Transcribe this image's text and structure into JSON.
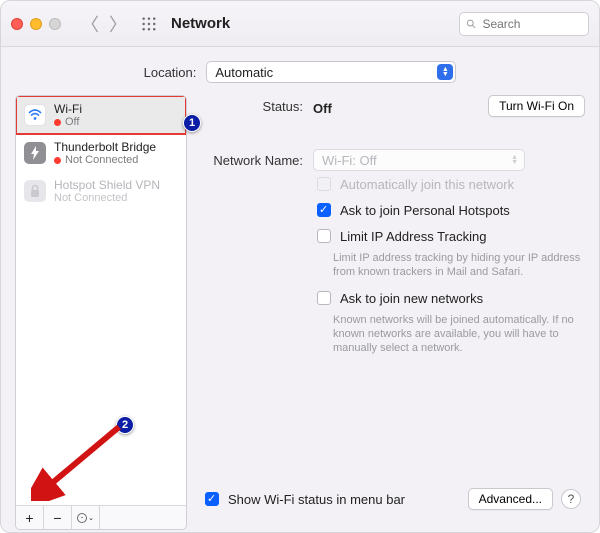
{
  "header": {
    "title": "Network",
    "search_placeholder": "Search"
  },
  "location": {
    "label": "Location:",
    "value": "Automatic"
  },
  "sidebar": {
    "items": [
      {
        "name": "Wi-Fi",
        "status_label": "Off",
        "status_color": "#ff3b30"
      },
      {
        "name": "Thunderbolt Bridge",
        "status_label": "Not Connected",
        "status_color": "#ff3b30"
      },
      {
        "name": "Hotspot Shield VPN",
        "status_label": "Not Connected",
        "status_color": ""
      }
    ]
  },
  "main": {
    "status_label": "Status:",
    "status_value": "Off",
    "toggle_button": "Turn Wi-Fi On",
    "network_name_label": "Network Name:",
    "network_name_value": "Wi-Fi: Off",
    "auto_join_label": "Automatically join this network",
    "ask_hotspots_label": "Ask to join Personal Hotspots",
    "limit_ip_label": "Limit IP Address Tracking",
    "limit_ip_sub": "Limit IP address tracking by hiding your IP address from known trackers in Mail and Safari.",
    "ask_new_label": "Ask to join new networks",
    "ask_new_sub": "Known networks will be joined automatically. If no known networks are available, you will have to manually select a network.",
    "show_status_label": "Show Wi-Fi status in menu bar",
    "advanced_button": "Advanced..."
  },
  "toolbar": {
    "add": "+",
    "remove": "−",
    "more": "⊙"
  },
  "annotations": {
    "badge1": "1",
    "badge2": "2"
  }
}
